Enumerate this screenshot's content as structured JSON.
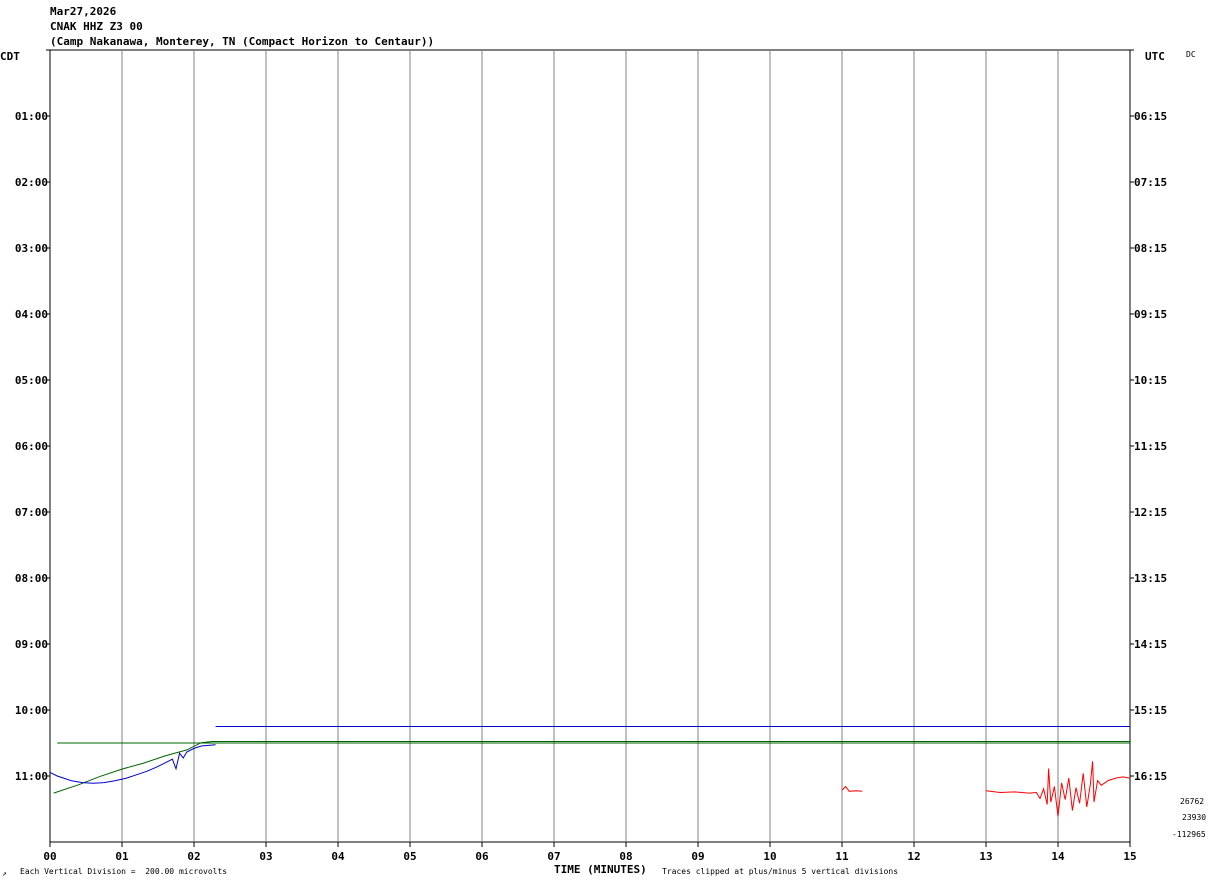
{
  "header": {
    "date": "Mar27,2026",
    "station": "CNAK HHZ Z3 00",
    "location": "(Camp Nakanawa, Monterey, TN (Compact Horizon to Centaur))"
  },
  "labels": {
    "left_tz": "CDT",
    "right_tz": "UTC",
    "dc": "DC",
    "footer_left": "Each Vertical Division =  200.00 microvolts",
    "footer_right": "Traces clipped at plus/minus 5 vertical divisions",
    "corner_mark": "↗"
  },
  "stats": [
    "26762",
    "23930",
    "-112965"
  ],
  "colors": {
    "grid": "#808080",
    "trace_blue": "#0000cc",
    "trace_green": "#006400",
    "trace_red": "#ff0000"
  },
  "chart_data": {
    "type": "line",
    "title": "",
    "xlabel": "TIME (MINUTES)",
    "xlim": [
      0,
      15
    ],
    "x_ticks": [
      "00",
      "01",
      "02",
      "03",
      "04",
      "05",
      "06",
      "07",
      "08",
      "09",
      "10",
      "11",
      "12",
      "13",
      "14",
      "15"
    ],
    "rows": 12,
    "left_row_labels": [
      "",
      "01:00",
      "02:00",
      "03:00",
      "04:00",
      "05:00",
      "06:00",
      "07:00",
      "08:00",
      "09:00",
      "10:00",
      "11:00"
    ],
    "right_row_labels": [
      "",
      "06:15",
      "07:15",
      "08:15",
      "09:15",
      "10:15",
      "11:15",
      "12:15",
      "13:15",
      "14:15",
      "15:15",
      "16:15"
    ],
    "series": [
      {
        "row": 10.5,
        "color": "#006400",
        "points": [
          [
            0.1,
            0.0
          ],
          [
            15,
            0.0
          ]
        ]
      },
      {
        "row": 10.25,
        "color": "#0000cc",
        "points": [
          [
            2.3,
            0.0
          ],
          [
            15,
            0.0
          ]
        ]
      },
      {
        "row": 10.75,
        "color": "#006400",
        "points": [
          [
            0.05,
            -2.8
          ],
          [
            0.4,
            -2.1
          ],
          [
            0.7,
            -1.4
          ],
          [
            1.0,
            -0.8
          ],
          [
            1.3,
            -0.3
          ],
          [
            1.6,
            0.3
          ],
          [
            1.9,
            0.8
          ],
          [
            2.1,
            1.4
          ],
          [
            2.25,
            1.5
          ],
          [
            15,
            1.5
          ]
        ]
      },
      {
        "row": 11.0,
        "color": "#0000cc",
        "points": [
          [
            0.0,
            0.3
          ],
          [
            0.1,
            0.0
          ],
          [
            0.2,
            -0.2
          ],
          [
            0.3,
            -0.4
          ],
          [
            0.45,
            -0.55
          ],
          [
            0.6,
            -0.6
          ],
          [
            0.75,
            -0.55
          ],
          [
            0.9,
            -0.4
          ],
          [
            1.05,
            -0.2
          ],
          [
            1.2,
            0.1
          ],
          [
            1.35,
            0.4
          ],
          [
            1.5,
            0.8
          ],
          [
            1.6,
            1.1
          ],
          [
            1.7,
            1.4
          ],
          [
            1.75,
            0.6
          ],
          [
            1.8,
            1.9
          ],
          [
            1.85,
            1.5
          ],
          [
            1.9,
            2.0
          ],
          [
            2.0,
            2.3
          ],
          [
            2.1,
            2.5
          ],
          [
            2.2,
            2.55
          ],
          [
            2.3,
            2.6
          ]
        ]
      },
      {
        "row": 11.25,
        "color": "#ff0000",
        "points": [
          [
            11.0,
            0.2
          ],
          [
            11.05,
            0.5
          ],
          [
            11.1,
            0.1
          ],
          [
            11.2,
            0.15
          ],
          [
            11.28,
            0.1
          ]
        ]
      },
      {
        "row": 11.25,
        "color": "#ff0000",
        "points": [
          [
            13.0,
            0.15
          ],
          [
            13.2,
            0.0
          ],
          [
            13.4,
            0.05
          ],
          [
            13.6,
            -0.05
          ],
          [
            13.7,
            0.0
          ],
          [
            13.75,
            -0.5
          ],
          [
            13.8,
            0.3
          ],
          [
            13.85,
            -1.0
          ],
          [
            13.87,
            2.0
          ],
          [
            13.9,
            -0.8
          ],
          [
            13.95,
            0.5
          ],
          [
            14.0,
            -2.0
          ],
          [
            14.05,
            0.8
          ],
          [
            14.1,
            -0.6
          ],
          [
            14.15,
            1.2
          ],
          [
            14.2,
            -1.5
          ],
          [
            14.25,
            0.4
          ],
          [
            14.3,
            -0.9
          ],
          [
            14.35,
            1.6
          ],
          [
            14.4,
            -1.2
          ],
          [
            14.45,
            0.7
          ],
          [
            14.48,
            2.6
          ],
          [
            14.5,
            -0.8
          ],
          [
            14.55,
            1.0
          ],
          [
            14.6,
            0.6
          ],
          [
            14.7,
            1.0
          ],
          [
            14.8,
            1.2
          ],
          [
            14.9,
            1.3
          ],
          [
            15.0,
            1.2
          ]
        ]
      }
    ]
  }
}
